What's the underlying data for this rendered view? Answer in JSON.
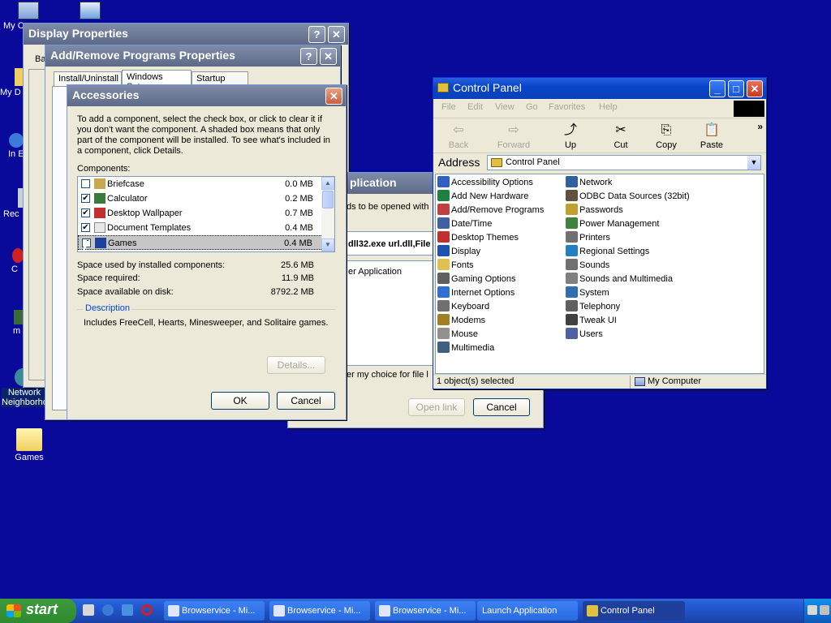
{
  "desktop": {
    "icons": [
      {
        "label": "My C"
      },
      {
        "label": ""
      },
      {
        "label": "My D"
      },
      {
        "label": "In Ex"
      },
      {
        "label": "Rec"
      },
      {
        "label": "C"
      },
      {
        "label": "m"
      },
      {
        "label": "Network Neighborho"
      },
      {
        "label": "Games"
      }
    ]
  },
  "display_props": {
    "title": "Display Properties",
    "help": "?",
    "close": "✕",
    "fragment": "Ba"
  },
  "addremove": {
    "title": "Add/Remove Programs Properties",
    "help": "?",
    "close": "✕",
    "tabs": [
      "Install/Uninstall",
      "Windows Setup",
      "Startup Disk"
    ]
  },
  "launch_app": {
    "title_fragment": "plication",
    "line1": "ds to be opened with",
    "line2": "dll32.exe url.dll,File",
    "line3": "er Application",
    "line4": "er my choice for file l",
    "open_btn": "Open link",
    "cancel_btn": "Cancel"
  },
  "accessories": {
    "title": "Accessories",
    "close": "✕",
    "instructions": "To add a component, select the check box, or click to clear it if you don't want the component. A shaded box means that only part of the component will be installed. To see what's included in a component, click Details.",
    "components_label": "Components:",
    "components": [
      {
        "name": "Briefcase",
        "size": "0.0 MB",
        "checked": false,
        "icon_color": "#c8a850"
      },
      {
        "name": "Calculator",
        "size": "0.2 MB",
        "checked": true,
        "icon_color": "#3a7a3a"
      },
      {
        "name": "Desktop Wallpaper",
        "size": "0.7 MB",
        "checked": true,
        "icon_color": "#c03030"
      },
      {
        "name": "Document Templates",
        "size": "0.4 MB",
        "checked": true,
        "icon_color": "#e8e8e8"
      },
      {
        "name": "Games",
        "size": "0.4 MB",
        "checked": true,
        "icon_color": "#2040a0"
      }
    ],
    "space_used_label": "Space used by installed components:",
    "space_used": "25.6 MB",
    "space_required_label": "Space required:",
    "space_required": "11.9 MB",
    "space_available_label": "Space available on disk:",
    "space_available": "8792.2 MB",
    "description_label": "Description",
    "description": "Includes FreeCell, Hearts, Minesweeper, and Solitaire games.",
    "details_btn": "Details...",
    "ok_btn": "OK",
    "cancel_btn": "Cancel"
  },
  "control_panel": {
    "title": "Control Panel",
    "min": "_",
    "max": "□",
    "close": "✕",
    "menu": [
      "File",
      "Edit",
      "View",
      "Go",
      "Favorites",
      "Help"
    ],
    "toolbar": [
      {
        "label": "Back",
        "glyph": "⇦",
        "enabled": false
      },
      {
        "label": "Forward",
        "glyph": "⇨",
        "enabled": false
      },
      {
        "label": "Up",
        "glyph": "⤴",
        "enabled": true
      },
      {
        "label": "Cut",
        "glyph": "✂",
        "enabled": true
      },
      {
        "label": "Copy",
        "glyph": "⎘",
        "enabled": true
      },
      {
        "label": "Paste",
        "glyph": "📋",
        "enabled": true
      }
    ],
    "chevron": "»",
    "address_label": "Address",
    "address_value": "Control Panel",
    "items_left": [
      {
        "label": "Accessibility Options",
        "color": "#3060c0"
      },
      {
        "label": "Add New Hardware",
        "color": "#208040"
      },
      {
        "label": "Add/Remove Programs",
        "color": "#c04040"
      },
      {
        "label": "Date/Time",
        "color": "#4060a0"
      },
      {
        "label": "Desktop Themes",
        "color": "#c03030"
      },
      {
        "label": "Display",
        "color": "#2050b0"
      },
      {
        "label": "Fonts",
        "color": "#e0c050"
      },
      {
        "label": "Gaming Options",
        "color": "#606060"
      },
      {
        "label": "Internet Options",
        "color": "#3070d0"
      },
      {
        "label": "Keyboard",
        "color": "#707070"
      },
      {
        "label": "Modems",
        "color": "#a08020"
      },
      {
        "label": "Mouse",
        "color": "#909090"
      },
      {
        "label": "Multimedia",
        "color": "#406080"
      }
    ],
    "items_right": [
      {
        "label": "Network",
        "color": "#3060a0"
      },
      {
        "label": "ODBC Data Sources (32bit)",
        "color": "#605040"
      },
      {
        "label": "Passwords",
        "color": "#c0a030"
      },
      {
        "label": "Power Management",
        "color": "#408040"
      },
      {
        "label": "Printers",
        "color": "#707070"
      },
      {
        "label": "Regional Settings",
        "color": "#2080c0"
      },
      {
        "label": "Sounds",
        "color": "#707070"
      },
      {
        "label": "Sounds and Multimedia",
        "color": "#808080"
      },
      {
        "label": "System",
        "color": "#3070b0"
      },
      {
        "label": "Telephony",
        "color": "#606060"
      },
      {
        "label": "Tweak UI",
        "color": "#404040"
      },
      {
        "label": "Users",
        "color": "#5060a0"
      }
    ],
    "status_left": "1 object(s) selected",
    "status_right": "My Computer"
  },
  "taskbar": {
    "start": "start",
    "tasks": [
      {
        "label": "Browservice - Mi..."
      },
      {
        "label": "Browservice - Mi..."
      },
      {
        "label": "Browservice - Mi..."
      },
      {
        "label": "Launch Application"
      },
      {
        "label": "Control Panel"
      }
    ]
  }
}
